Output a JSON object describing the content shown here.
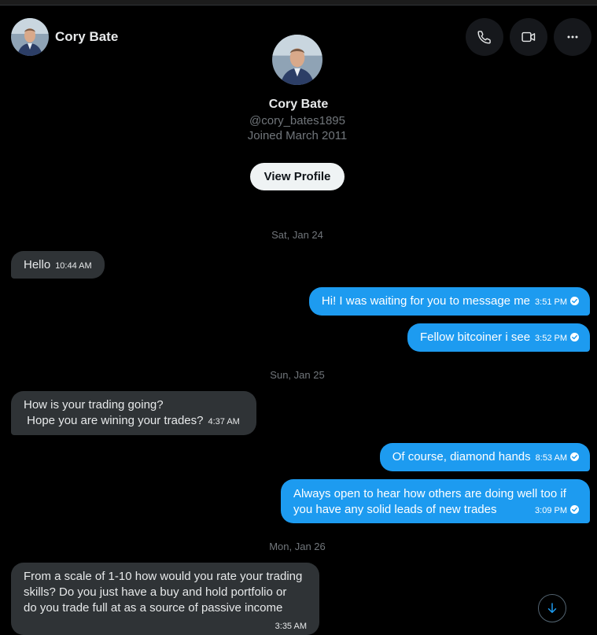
{
  "header": {
    "name": "Cory Bate"
  },
  "profile": {
    "name": "Cory Bate",
    "handle": "@cory_bates1895",
    "joined": "Joined March 2011",
    "view_profile_label": "View Profile"
  },
  "icons": {
    "call": "phone-icon",
    "video": "video-icon",
    "more": "more-icon",
    "scroll": "arrow-down-icon"
  },
  "colors": {
    "sent_bubble": "#1d9bf0",
    "received_bubble": "#2f3336",
    "background": "#000000"
  },
  "dates": [
    "Sat, Jan 24",
    "Sun, Jan 25",
    "Mon, Jan 26"
  ],
  "messages": [
    {
      "direction": "received",
      "text": "Hello",
      "time": "10:44 AM"
    },
    {
      "direction": "sent",
      "text": "Hi! I was waiting for you to message me",
      "time": "3:51 PM"
    },
    {
      "direction": "sent",
      "text": "Fellow bitcoiner i see",
      "time": "3:52 PM"
    },
    {
      "direction": "received",
      "line1": "How is your trading going?",
      "line2": " Hope you are wining your trades?",
      "time": "4:37 AM"
    },
    {
      "direction": "sent",
      "text": "Of course, diamond hands",
      "time": "8:53 AM"
    },
    {
      "direction": "sent",
      "line1": "Always open to hear how others are doing well too if",
      "line2": "you have any solid leads of new trades",
      "time": "3:09 PM"
    },
    {
      "direction": "received",
      "line1": "From a scale of 1-10 how would you rate your trading",
      "line2": "skills? Do you just have a buy and hold portfolio or",
      "line3": "do you trade full at as a source of passive income",
      "time": "3:35 AM"
    }
  ]
}
